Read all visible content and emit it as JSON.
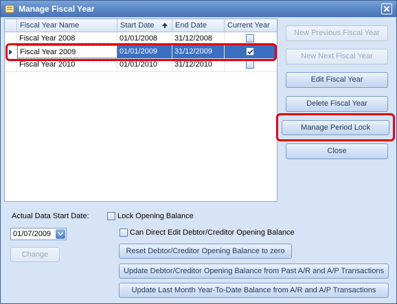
{
  "window": {
    "title": "Manage Fiscal Year"
  },
  "grid": {
    "columns": [
      "Fiscal Year Name",
      "Start Date",
      "End Date",
      "Current Year"
    ],
    "rows": [
      {
        "name": "Fiscal Year 2008",
        "start": "01/01/2008",
        "end": "31/12/2008",
        "current": false
      },
      {
        "name": "Fiscal Year 2009",
        "start": "01/01/2009",
        "end": "31/12/2009",
        "current": true
      },
      {
        "name": "Fiscal Year 2010",
        "start": "01/01/2010",
        "end": "31/12/2010",
        "current": false
      }
    ],
    "selected_row": 1,
    "sort_column": "Start Date",
    "sort_direction": "ascending"
  },
  "side_buttons": {
    "new_previous": "New Previous Fiscal Year",
    "new_next": "New Next Fiscal Year",
    "edit": "Edit Fiscal Year",
    "delete": "Delete Fiscal Year",
    "manage_period_lock": "Manage Period Lock",
    "close": "Close"
  },
  "bottom": {
    "actual_start_label": "Actual Data Start Date:",
    "actual_start_value": "01/07/2009",
    "change_button": "Change",
    "lock_opening_label": "Lock Opening Balance",
    "can_direct_edit_label": "Can Direct Edit Debtor/Creditor Opening Balance",
    "reset_button": "Reset Debtor/Creditor Opening Balance to zero",
    "update_from_past_button": "Update Debtor/Creditor Opening Balance from Past A/R and A/P Transactions",
    "update_ytd_button": "Update Last Month Year-To-Date Balance from A/R and A/P Transactions"
  },
  "colors": {
    "selection": "#3a6fc1",
    "highlight": "#e00010",
    "titlebar": "#5b86c6"
  }
}
